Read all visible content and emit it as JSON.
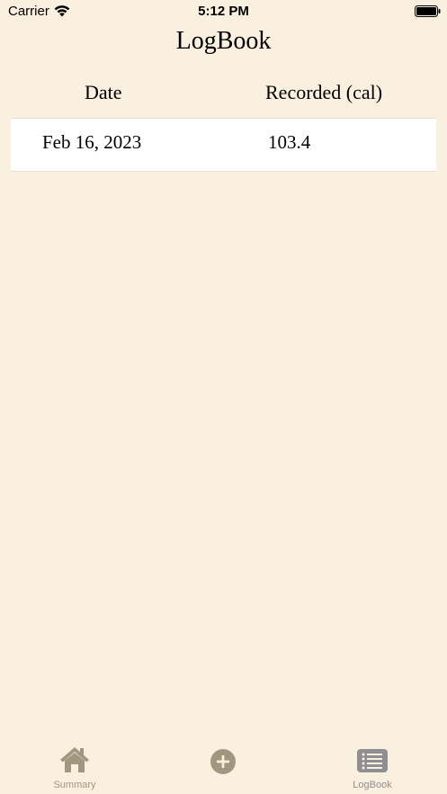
{
  "status_bar": {
    "carrier": "Carrier",
    "time": "5:12 PM",
    "wifi_icon": "wifi-icon",
    "battery_icon": "battery-icon"
  },
  "header": {
    "title": "LogBook"
  },
  "table": {
    "columns": [
      "Date",
      "Recorded (cal)"
    ],
    "rows": [
      {
        "date": "Feb 16, 2023",
        "recorded": "103.4"
      }
    ]
  },
  "tab_bar": {
    "tabs": [
      {
        "label": "Summary",
        "icon": "house-icon",
        "color": "#A0977F"
      },
      {
        "label": "",
        "icon": "plus-circle-icon",
        "color": "#A0977F"
      },
      {
        "label": "LogBook",
        "icon": "list-icon",
        "color": "#8E8E93"
      }
    ]
  },
  "colors": {
    "background": "#FAF0DF",
    "row_background": "#FFFFFF",
    "tab_accent": "#A0977F",
    "tab_selected": "#8E8E93"
  }
}
